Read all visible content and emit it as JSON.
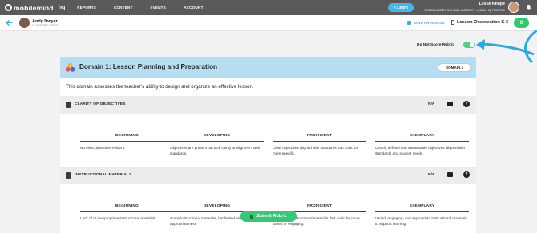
{
  "nav": {
    "logo_text": "mobilemind",
    "logo_suffix": "hq",
    "links": [
      "REPORTS",
      "CONTENT",
      "EVENTS",
      "ACCOUNT"
    ],
    "learn_button": "< Learn",
    "user_name": "Leslie Knope",
    "district": "GREEN ACRES SCHOOL DISTRICT ▾",
    "view_profile": "VIEW HQ PROFILE"
  },
  "subheader": {
    "teacher_name": "Andy Dwyer",
    "teacher_role": "CLASSIFIED STAFF",
    "save_label": "SAVE PROGRESS",
    "lesson_title": "Lesson Observation K-5",
    "score": "0"
  },
  "settings": {
    "do_not_score_label": "Do Not Score Rubric",
    "do_not_score_enabled": true
  },
  "domain": {
    "title": "Domain 1: Lesson Planning and Preparation",
    "badge": "DOMAIN 1",
    "description": "This domain assesses the teacher's ability to design and organize an effective lesson."
  },
  "criteria": [
    {
      "title": "CLARITY OF OBJECTIVES",
      "na": "N/A",
      "levels": [
        {
          "name": "BEGINNING",
          "text": "No clear objectives evident."
        },
        {
          "name": "DEVELOPING",
          "text": "Objectives are present but lack clarity or alignment with standards."
        },
        {
          "name": "PROFICIENT",
          "text": "Clear objectives aligned with standards, but could be more specific."
        },
        {
          "name": "EXEMPLARY",
          "text": "Clearly defined and measurable objectives aligned with standards and student needs."
        }
      ]
    },
    {
      "title": "INSTRUCTIONAL MATERIALS",
      "na": "N/A",
      "levels": [
        {
          "name": "BEGINNING",
          "text": "Lack of or inappropriate instructional materials."
        },
        {
          "name": "DEVELOPING",
          "text": "Some instructional materials, but limited relevance or appropriateness."
        },
        {
          "name": "PROFICIENT",
          "text": "Appropriate instructional materials, but could be more varied or engaging."
        },
        {
          "name": "EXEMPLARY",
          "text": "Varied, engaging, and appropriate instructional materials to support learning."
        }
      ]
    }
  ],
  "footer": {
    "submit_label": "Submit Rubric"
  },
  "colors": {
    "accent": "#4db3e6",
    "success": "#3cc47c",
    "domain_header": "#b8ddf1",
    "nav_bg": "#5a5a5c"
  }
}
